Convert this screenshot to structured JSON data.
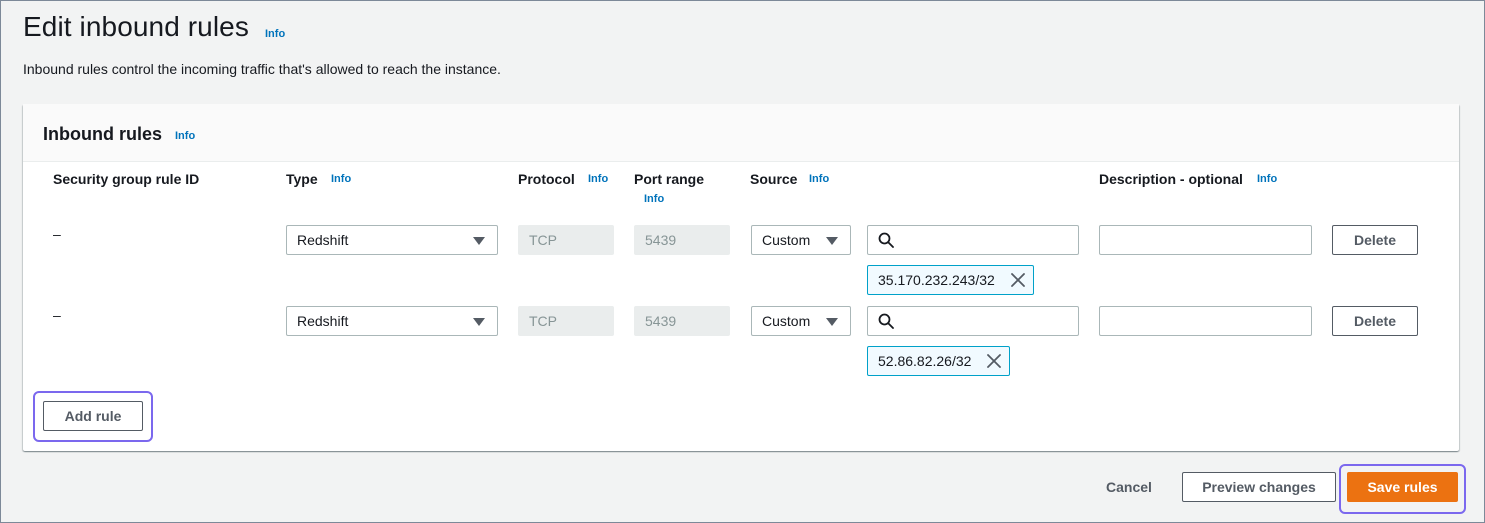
{
  "page": {
    "title": "Edit inbound rules",
    "title_info": "Info",
    "description": "Inbound rules control the incoming traffic that's allowed to reach the instance."
  },
  "panel": {
    "title": "Inbound rules",
    "title_info": "Info",
    "columns": {
      "rule_id": "Security group rule ID",
      "type": "Type",
      "type_info": "Info",
      "protocol": "Protocol",
      "protocol_info": "Info",
      "port_range": "Port range",
      "port_range_info": "Info",
      "source": "Source",
      "source_info": "Info",
      "description": "Description - optional",
      "description_info": "Info"
    },
    "rules": [
      {
        "rule_id": "–",
        "type": "Redshift",
        "protocol": "TCP",
        "port_range": "5439",
        "source": "Custom",
        "search_value": "",
        "cidr_token": "35.170.232.243/32",
        "description": "",
        "delete_label": "Delete"
      },
      {
        "rule_id": "–",
        "type": "Redshift",
        "protocol": "TCP",
        "port_range": "5439",
        "source": "Custom",
        "search_value": "",
        "cidr_token": "52.86.82.26/32",
        "description": "",
        "delete_label": "Delete"
      }
    ],
    "add_rule_label": "Add rule"
  },
  "footer": {
    "cancel_label": "Cancel",
    "preview_label": "Preview changes",
    "save_label": "Save rules"
  },
  "colors": {
    "accent": "#ec7211",
    "link": "#0073bb",
    "token_border": "#00a1c9",
    "focus_ring": "#7b68ee"
  }
}
